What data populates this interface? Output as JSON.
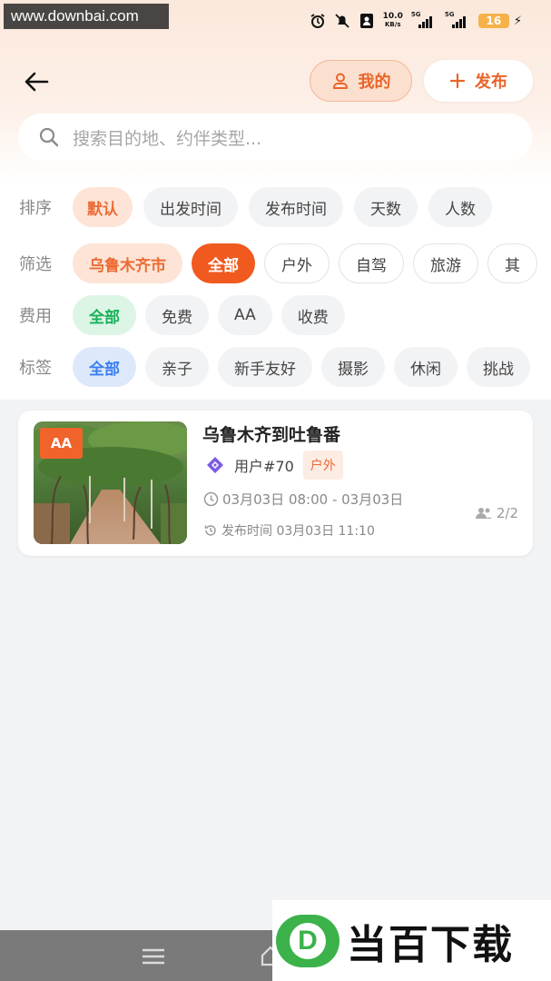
{
  "status_bar": {
    "watermark": "www.downbai.com",
    "net_speed_value": "10.0",
    "net_speed_unit": "KB/s",
    "signal_1": "5G",
    "signal_2": "5G",
    "battery": "16"
  },
  "header": {
    "mine_label": "我的",
    "publish_label": "发布"
  },
  "search": {
    "placeholder": "搜索目的地、约伴类型..."
  },
  "filters": {
    "sort": {
      "label": "排序",
      "options": [
        "默认",
        "出发时间",
        "发布时间",
        "天数",
        "人数"
      ],
      "selected": "默认"
    },
    "screen": {
      "label": "筛选",
      "city": "乌鲁木齐市",
      "options": [
        "全部",
        "户外",
        "自驾",
        "旅游",
        "其"
      ],
      "selected": "全部"
    },
    "fee": {
      "label": "费用",
      "options": [
        "全部",
        "免费",
        "AA",
        "收费"
      ],
      "selected": "全部"
    },
    "tag": {
      "label": "标签",
      "options": [
        "全部",
        "亲子",
        "新手友好",
        "摄影",
        "休闲",
        "挑战"
      ],
      "selected": "全部"
    }
  },
  "listing": {
    "badge": "AA",
    "title": "乌鲁木齐到吐鲁番",
    "user": "用户#70",
    "type_tag": "户外",
    "time_range": "03月03日 08:00 - 03月03日",
    "publish_time": "发布时间 03月03日 11:10",
    "people": "2/2"
  },
  "watermark_bottom": {
    "logo_letter": "D",
    "text": "当百下载"
  },
  "colors": {
    "accent_orange": "#f05a1e",
    "peach": "#fde4d6",
    "green": "#1ab05a",
    "blue": "#3b7ef0"
  }
}
